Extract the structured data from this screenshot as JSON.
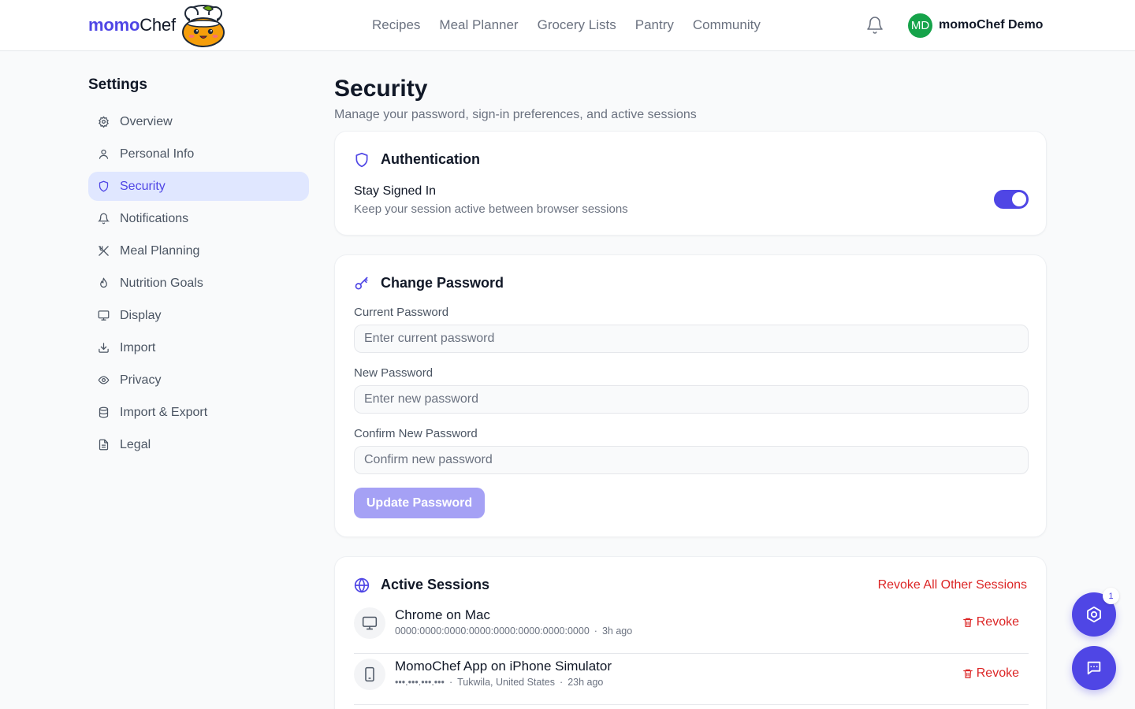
{
  "colors": {
    "accent": "#4f46e5",
    "danger": "#dc2626",
    "avatar": "#16a34a"
  },
  "header": {
    "brand_bold": "momo",
    "brand_rest": "Chef",
    "nav": [
      "Recipes",
      "Meal Planner",
      "Grocery Lists",
      "Pantry",
      "Community"
    ],
    "user_initials": "MD",
    "user_name": "momoChef Demo"
  },
  "sidebar": {
    "title": "Settings",
    "items": [
      {
        "label": "Overview",
        "icon": "gear-icon"
      },
      {
        "label": "Personal Info",
        "icon": "user-icon"
      },
      {
        "label": "Security",
        "icon": "shield-icon",
        "active": true
      },
      {
        "label": "Notifications",
        "icon": "bell-icon"
      },
      {
        "label": "Meal Planning",
        "icon": "utensils-icon"
      },
      {
        "label": "Nutrition Goals",
        "icon": "flame-icon"
      },
      {
        "label": "Display",
        "icon": "monitor-icon"
      },
      {
        "label": "Import",
        "icon": "download-icon"
      },
      {
        "label": "Privacy",
        "icon": "eye-icon"
      },
      {
        "label": "Import & Export",
        "icon": "database-icon"
      },
      {
        "label": "Legal",
        "icon": "document-icon"
      }
    ]
  },
  "main": {
    "title": "Security",
    "subtitle": "Manage your password, sign-in preferences, and active sessions",
    "auth": {
      "heading": "Authentication",
      "stay_label": "Stay Signed In",
      "stay_desc": "Keep your session active between browser sessions",
      "stay_enabled": true
    },
    "password": {
      "heading": "Change Password",
      "current_label": "Current Password",
      "current_placeholder": "Enter current password",
      "new_label": "New Password",
      "new_placeholder": "Enter new password",
      "confirm_label": "Confirm New Password",
      "confirm_placeholder": "Confirm new password",
      "button": "Update Password"
    },
    "sessions": {
      "heading": "Active Sessions",
      "revoke_all": "Revoke All Other Sessions",
      "items": [
        {
          "name": "Chrome on Mac",
          "ip": "0000:0000:0000:0000:0000:0000:0000:0000",
          "location": "",
          "time": "3h ago",
          "device": "desktop-icon",
          "revoke": "Revoke"
        },
        {
          "name": "MomoChef App on iPhone Simulator",
          "ip": "•••.•••.•••.•••",
          "location": "Tukwila, United States",
          "time": "23h ago",
          "device": "phone-icon",
          "revoke": "Revoke"
        }
      ]
    }
  },
  "floating": {
    "badge_count": "1"
  }
}
